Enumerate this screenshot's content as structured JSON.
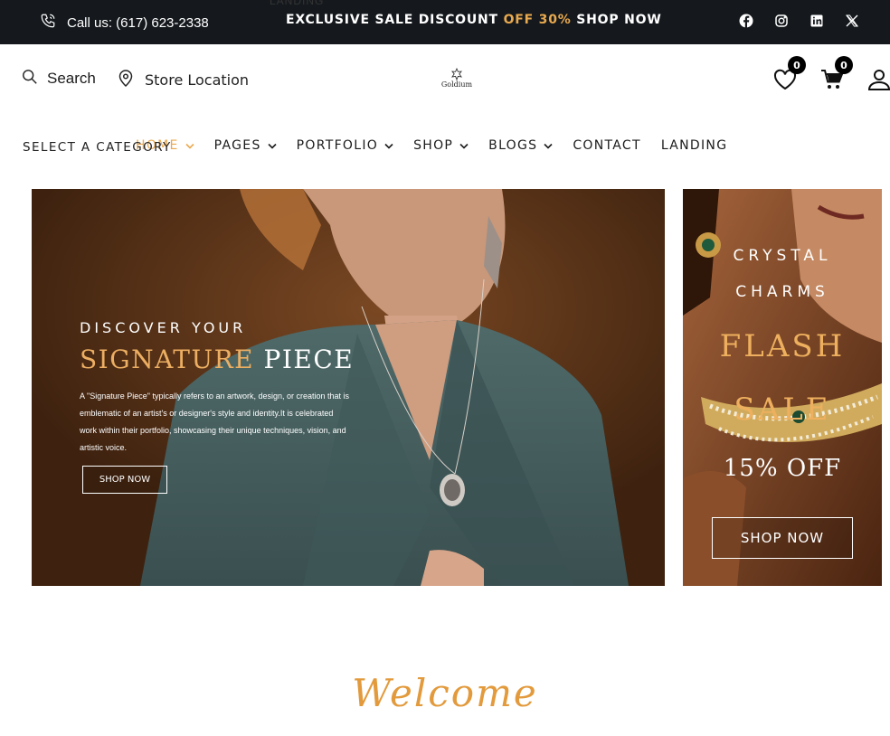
{
  "topbar": {
    "phone_label": "Call us: (617) 623-2338",
    "promo_before": "EXCLUSIVE SALE DISCOUNT",
    "promo_accent": "OFF 30%",
    "promo_after": "SHOP NOW",
    "accent_color": "#e9a94f",
    "socials": [
      "facebook-icon",
      "instagram-icon",
      "linkedin-icon",
      "x-icon"
    ]
  },
  "ghost_label": "LANDING",
  "header": {
    "search_placeholder": "Search",
    "store_location": "Store Location",
    "logo_text": "Goldium",
    "wishlist_count": "0",
    "cart_count": "0"
  },
  "nav": {
    "category": "SELECT A CATEGORY",
    "items": [
      {
        "label": "HOME",
        "dropdown": true,
        "active": true
      },
      {
        "label": "PAGES",
        "dropdown": true
      },
      {
        "label": "PORTFOLIO",
        "dropdown": true
      },
      {
        "label": "SHOP",
        "dropdown": true
      },
      {
        "label": "BLOGS",
        "dropdown": true
      },
      {
        "label": "CONTACT",
        "dropdown": false
      },
      {
        "label": "LANDING",
        "dropdown": false
      }
    ]
  },
  "hero": {
    "eyebrow": "DISCOVER YOUR",
    "headline_gold": "SIGNATURE",
    "headline_white": "PIECE",
    "description": "A \"Signature Piece\" typically refers to an artwork, design, or creation that is emblematic of an artist's or designer's style and identity.It is celebrated work within their portfolio, showcasing their unique techniques, vision, and artistic voice.",
    "button": "SHOP NOW"
  },
  "promo": {
    "line1": "CRYSTAL",
    "line2": "CHARMS",
    "flash1": "FLASH",
    "flash2": "SALE",
    "offer": "15% OFF",
    "button": "SHOP NOW"
  },
  "welcome": "Welcome"
}
